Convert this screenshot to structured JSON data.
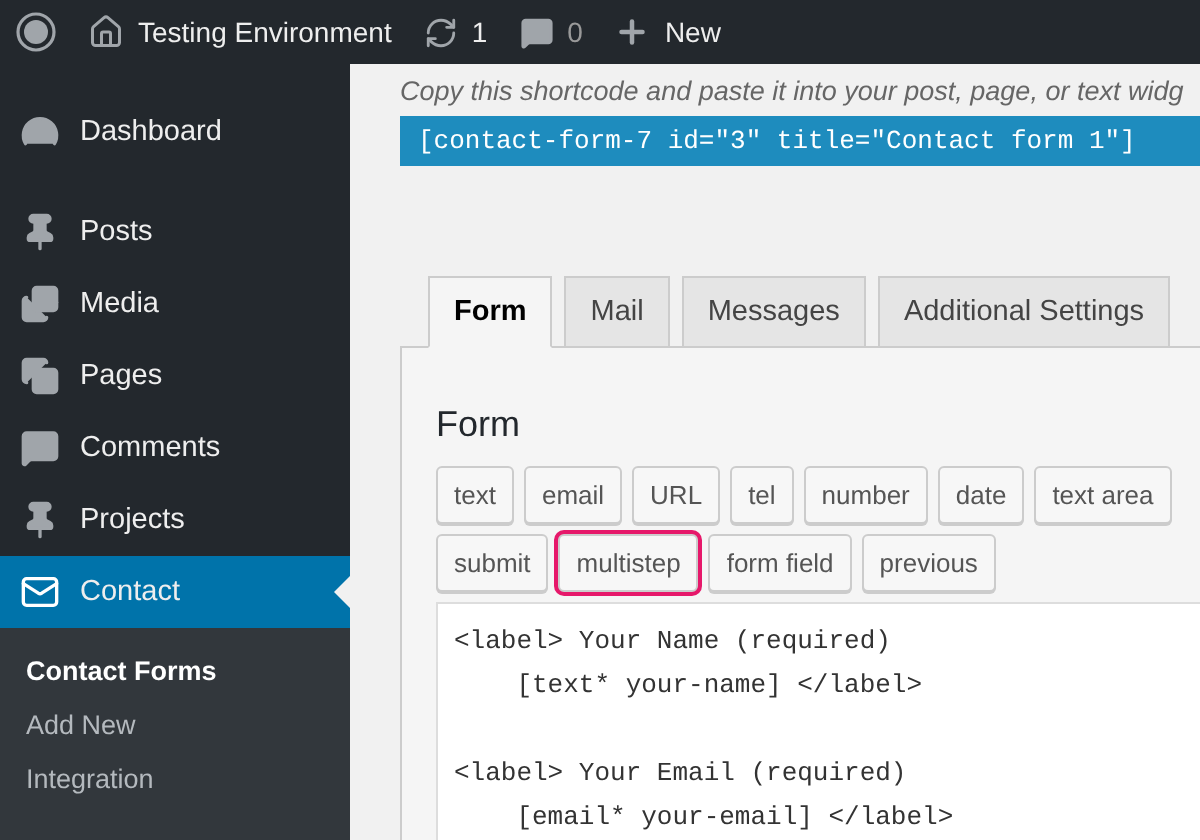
{
  "admin_bar": {
    "site_name": "Testing Environment",
    "updates": "1",
    "comments": "0",
    "new_label": "New"
  },
  "sidebar": {
    "items": [
      {
        "label": "Dashboard",
        "selected": false
      },
      {
        "label": "Posts",
        "selected": false
      },
      {
        "label": "Media",
        "selected": false
      },
      {
        "label": "Pages",
        "selected": false
      },
      {
        "label": "Comments",
        "selected": false
      },
      {
        "label": "Projects",
        "selected": false
      },
      {
        "label": "Contact",
        "selected": true
      }
    ],
    "submenu": [
      {
        "label": "Contact Forms",
        "selected": true
      },
      {
        "label": "Add New",
        "selected": false
      },
      {
        "label": "Integration",
        "selected": false
      }
    ]
  },
  "shortcode": {
    "hint": "Copy this shortcode and paste it into your post, page, or text widg",
    "code": "[contact-form-7 id=\"3\" title=\"Contact form 1\"]"
  },
  "tabs": [
    {
      "label": "Form",
      "selected": true
    },
    {
      "label": "Mail",
      "selected": false
    },
    {
      "label": "Messages",
      "selected": false
    },
    {
      "label": "Additional Settings",
      "selected": false
    }
  ],
  "panel": {
    "heading": "Form",
    "tag_rows": [
      [
        {
          "label": "text",
          "highlighted": false
        },
        {
          "label": "email",
          "highlighted": false
        },
        {
          "label": "URL",
          "highlighted": false
        },
        {
          "label": "tel",
          "highlighted": false
        },
        {
          "label": "number",
          "highlighted": false
        },
        {
          "label": "date",
          "highlighted": false
        },
        {
          "label": "text area",
          "highlighted": false
        }
      ],
      [
        {
          "label": "submit",
          "highlighted": false
        },
        {
          "label": "multistep",
          "highlighted": true
        },
        {
          "label": "form field",
          "highlighted": false
        },
        {
          "label": "previous",
          "highlighted": false
        }
      ]
    ],
    "code": "<label> Your Name (required)\n    [text* your-name] </label>\n\n<label> Your Email (required)\n    [email* your-email] </label>"
  }
}
